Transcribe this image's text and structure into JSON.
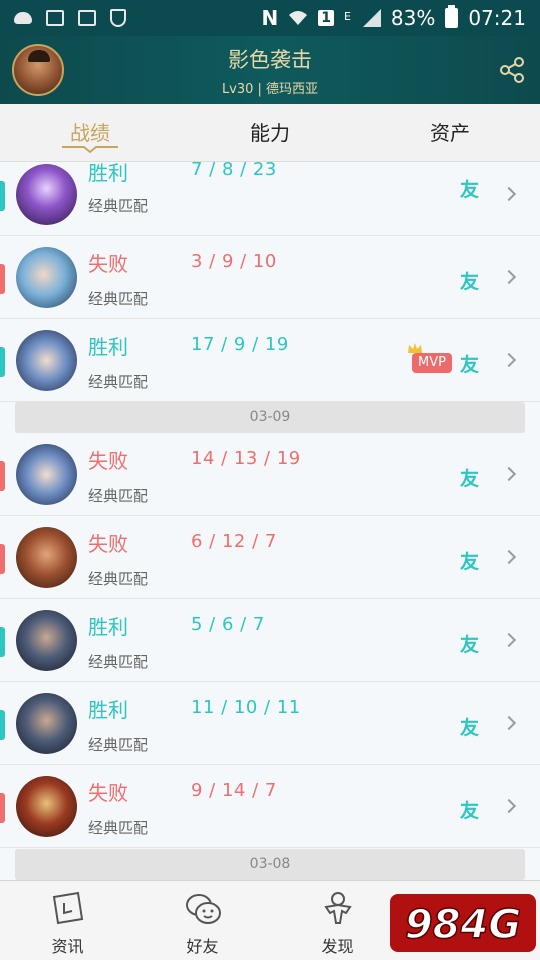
{
  "status_bar": {
    "battery": "83%",
    "time": "07:21",
    "network": "N",
    "sim": "1",
    "signal_type": "E"
  },
  "header": {
    "title": "影色袭击",
    "subtitle": "Lv30 | 德玛西亚"
  },
  "tabs": [
    {
      "label": "战绩",
      "active": true
    },
    {
      "label": "能力",
      "active": false
    },
    {
      "label": "资产",
      "active": false
    }
  ],
  "matches": [
    {
      "result": "胜利",
      "outcome": "win",
      "kda": "7 / 8 / 23",
      "mode": "经典匹配",
      "friend": "友",
      "mvp": false,
      "champion_icon": "champion-purple-mage"
    },
    {
      "result": "失败",
      "outcome": "loss",
      "kda": "3 / 9 / 10",
      "mode": "经典匹配",
      "friend": "友",
      "mvp": false,
      "champion_icon": "champion-white-hair"
    },
    {
      "result": "胜利",
      "outcome": "win",
      "kda": "17 / 9 / 19",
      "mode": "经典匹配",
      "friend": "友",
      "mvp": true,
      "mvp_label": "MVP",
      "champion_icon": "champion-blue-helmet"
    },
    {
      "date": "03-09"
    },
    {
      "result": "失败",
      "outcome": "loss",
      "kda": "14 / 13 / 19",
      "mode": "经典匹配",
      "friend": "友",
      "mvp": false,
      "champion_icon": "champion-blue-helmet"
    },
    {
      "result": "失败",
      "outcome": "loss",
      "kda": "6 / 12 / 7",
      "mode": "经典匹配",
      "friend": "友",
      "mvp": false,
      "champion_icon": "champion-warrior"
    },
    {
      "result": "胜利",
      "outcome": "win",
      "kda": "5 / 6 / 7",
      "mode": "经典匹配",
      "friend": "友",
      "mvp": false,
      "champion_icon": "champion-swordsman"
    },
    {
      "result": "胜利",
      "outcome": "win",
      "kda": "11 / 10 / 11",
      "mode": "经典匹配",
      "friend": "友",
      "mvp": false,
      "champion_icon": "champion-swordsman"
    },
    {
      "result": "失败",
      "outcome": "loss",
      "kda": "9 / 14 / 7",
      "mode": "经典匹配",
      "friend": "友",
      "mvp": false,
      "champion_icon": "champion-monkey"
    },
    {
      "date": "03-08"
    }
  ],
  "bottom_nav": [
    {
      "label": "资讯",
      "icon": "news-icon"
    },
    {
      "label": "好友",
      "icon": "friends-icon"
    },
    {
      "label": "发现",
      "icon": "discover-icon"
    },
    {
      "label": "",
      "icon": "bag-icon"
    }
  ],
  "watermark": {
    "text": "984G"
  },
  "colors": {
    "win": "#2dc6c0",
    "loss": "#f06e6e",
    "gold": "#c9a45c",
    "header_bg": "#0d4a4e"
  }
}
